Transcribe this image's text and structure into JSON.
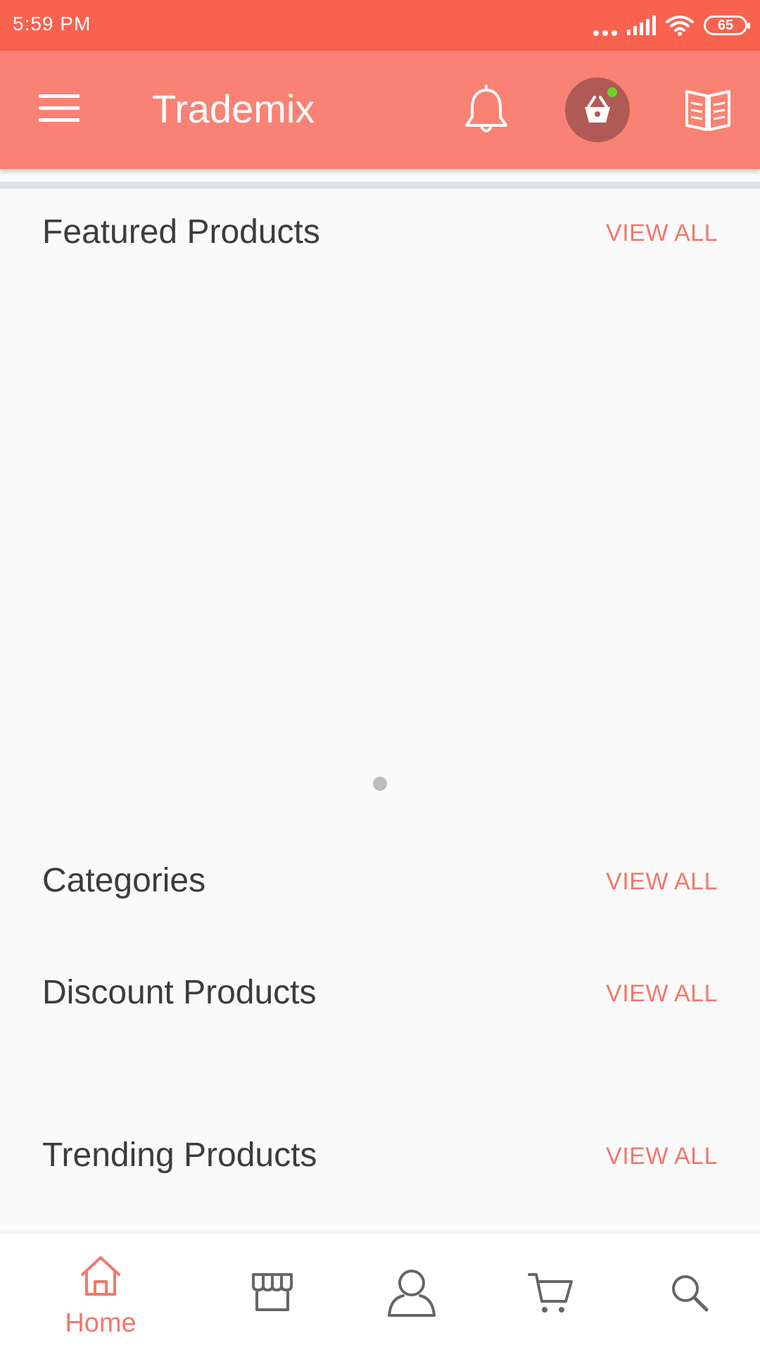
{
  "status_bar": {
    "time": "5:59 PM",
    "battery": "65",
    "icons": [
      "dots-icon",
      "signal-icon",
      "wifi-icon",
      "battery-icon"
    ]
  },
  "app_bar": {
    "title": "Trademix",
    "icons": [
      "menu-icon",
      "bell-icon",
      "basket-icon",
      "book-icon"
    ],
    "color": "#f98274"
  },
  "sections": {
    "featured": {
      "title": "Featured Products",
      "action": "VIEW ALL"
    },
    "categories": {
      "title": "Categories",
      "action": "VIEW ALL"
    },
    "discount": {
      "title": "Discount Products",
      "action": "VIEW ALL"
    },
    "trending": {
      "title": "Trending Products",
      "action": "VIEW ALL"
    }
  },
  "bottom_nav": {
    "items": [
      {
        "label": "Home",
        "icon": "home-icon",
        "active": true
      },
      {
        "label": "",
        "icon": "store-icon"
      },
      {
        "label": "",
        "icon": "user-icon"
      },
      {
        "label": "",
        "icon": "cart-icon"
      },
      {
        "label": "",
        "icon": "search-icon"
      }
    ]
  },
  "colors": {
    "status_bar": "#f8624f",
    "accent": "#f4776a",
    "badge": "#6ad42b"
  }
}
